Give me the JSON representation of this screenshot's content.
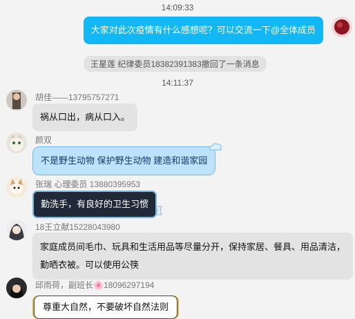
{
  "timestamps": [
    "14:09:33",
    "14:11:37"
  ],
  "self_message": {
    "text": "大家对此次疫情有什么感想呢？可以交流一下@全体成员"
  },
  "recall_notice": "王星莲 纪律委员18382391383撤回了一条消息",
  "messages": [
    {
      "sender": "胡佳——13795757271",
      "text": "祸从口出，病从口入。"
    },
    {
      "sender": "颜双",
      "text": "不是野生动物 保护野生动物 建造和谐家园"
    },
    {
      "sender": "张瑞 心理委员 13880395953",
      "text": "勤洗手，有良好的卫生习惯"
    },
    {
      "sender": "18王立献15228043980",
      "text": "家庭成员间毛巾、玩具和生活用品等尽量分开，保持家居、餐具、用品清洁，勤晒衣被。可以使用公筷"
    },
    {
      "sender": "邱雨荷，副班长🌸18096297194",
      "text": "尊重大自然，不要破坏自然法则"
    }
  ],
  "colors": {
    "self_bubble": "#12b7f5",
    "gray_bubble": "#e3e3e3",
    "sky_bubble": "#bde3fb",
    "dark_bubble": "#1f2937"
  }
}
